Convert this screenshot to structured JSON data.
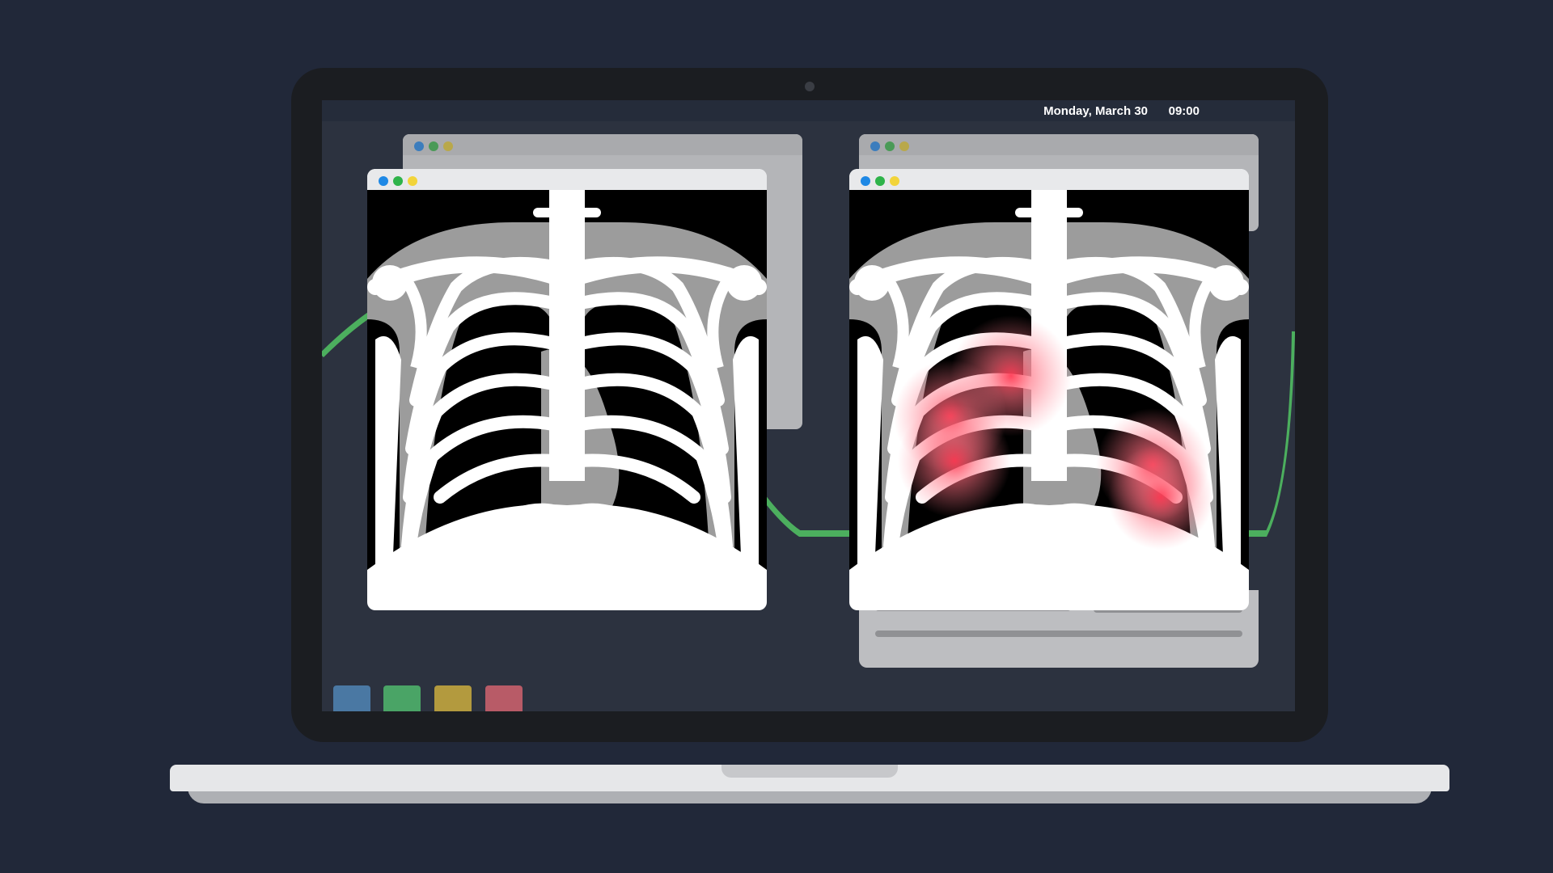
{
  "menubar": {
    "date": "Monday, March 30",
    "time": "09:00"
  },
  "colors": {
    "background": "#212839",
    "desktop": "#2c323f",
    "accent_green": "#4caf5e",
    "highlight_red": "#ff3c55"
  },
  "windows": [
    {
      "name": "xray-original",
      "type": "chest-xray",
      "highlights": false
    },
    {
      "name": "xray-analyzed",
      "type": "chest-xray",
      "highlights": true
    }
  ],
  "dock": [
    {
      "name": "blue-app",
      "color": "#4a78a3"
    },
    {
      "name": "green-app",
      "color": "#4aa466"
    },
    {
      "name": "yellow-app",
      "color": "#b39a3e"
    },
    {
      "name": "red-app",
      "color": "#b85b67"
    }
  ]
}
